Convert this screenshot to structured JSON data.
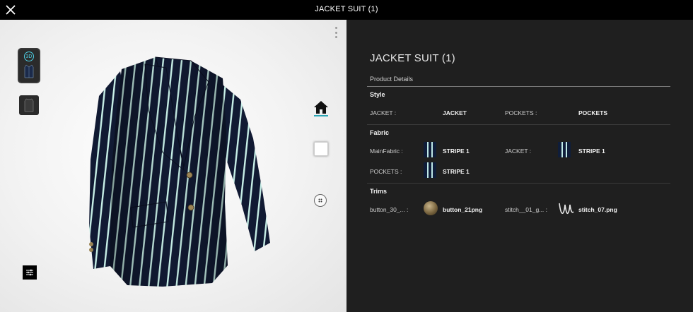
{
  "header": {
    "title": "JACKET SUIT (1)",
    "close_icon": "close-icon"
  },
  "viewer": {
    "thumbnails": [
      {
        "name": "front-view",
        "badge": "3D"
      },
      {
        "name": "back-view"
      }
    ],
    "side_icons": [
      "home-icon",
      "square-icon",
      "dots-icon"
    ],
    "menu_icon": "kebab-icon",
    "filter_icon": "filter-icon",
    "accent_color": "#4fd1e6"
  },
  "panel": {
    "title": "JACKET SUIT (1)",
    "product_details_label": "Product Details",
    "style": {
      "heading": "Style",
      "items": [
        {
          "label": "JACKET :",
          "value": "JACKET"
        },
        {
          "label": "POCKETS :",
          "value": "POCKETS"
        }
      ]
    },
    "fabric": {
      "heading": "Fabric",
      "items": [
        {
          "label": "MainFabric :",
          "value": "STRIPE 1"
        },
        {
          "label": "JACKET :",
          "value": "STRIPE 1"
        },
        {
          "label": "POCKETS :",
          "value": "STRIPE 1"
        }
      ]
    },
    "trims": {
      "heading": "Trims",
      "items": [
        {
          "label": "button_30_... :",
          "value": "button_21png"
        },
        {
          "label": "stitch__01_g... :",
          "value": "stitch_07.png"
        }
      ]
    }
  },
  "colors": {
    "panel_bg": "#1f1f1f",
    "viewer_bg": "#f2f2f2",
    "jacket_navy": "#111a33",
    "stripe": "#c7efe7"
  }
}
